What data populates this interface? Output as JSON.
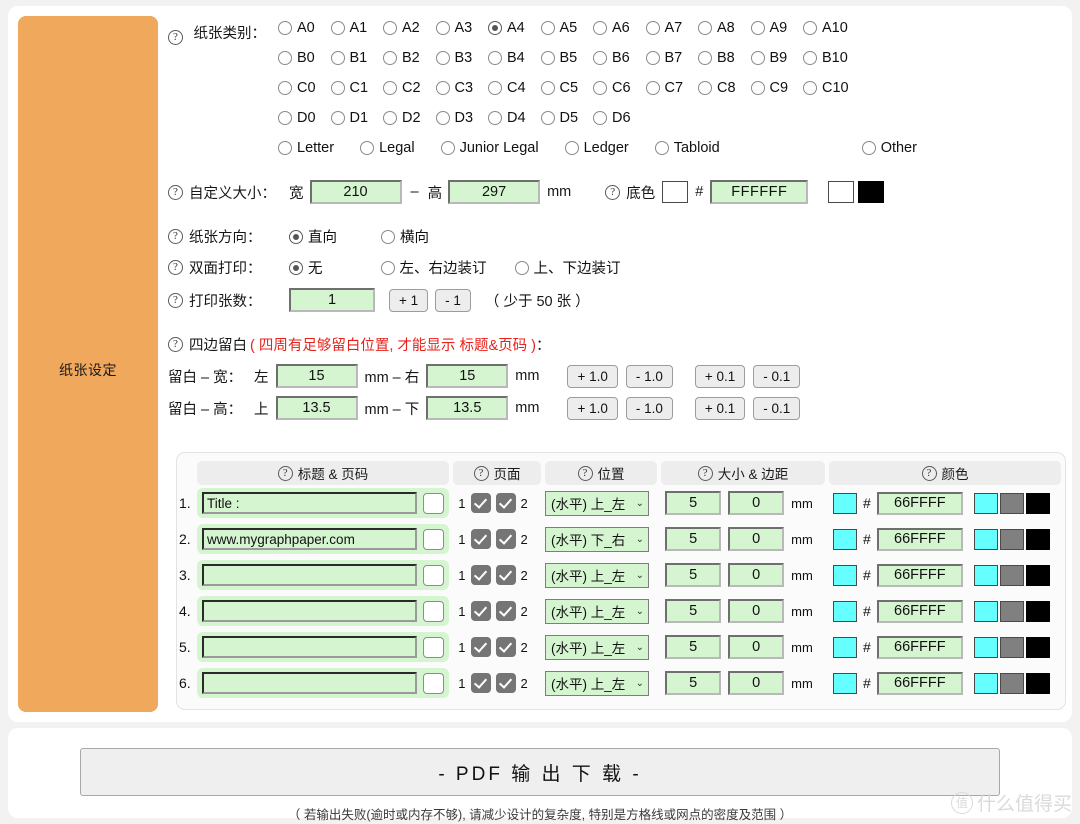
{
  "sidebar": {
    "label": "纸张设定"
  },
  "paper_class": {
    "label": "纸张类别：",
    "rows": [
      [
        "A0",
        "A1",
        "A2",
        "A3",
        "A4",
        "A5",
        "A6",
        "A7",
        "A8",
        "A9",
        "A10"
      ],
      [
        "B0",
        "B1",
        "B2",
        "B3",
        "B4",
        "B5",
        "B6",
        "B7",
        "B8",
        "B9",
        "B10"
      ],
      [
        "C0",
        "C1",
        "C2",
        "C3",
        "C4",
        "C5",
        "C6",
        "C7",
        "C8",
        "C9",
        "C10"
      ],
      [
        "D0",
        "D1",
        "D2",
        "D3",
        "D4",
        "D5",
        "D6"
      ]
    ],
    "named": [
      "Letter",
      "Legal",
      "Junior Legal",
      "Ledger",
      "Tabloid"
    ],
    "other": "Other",
    "selected": "A4"
  },
  "custom_size": {
    "label": "自定义大小：",
    "width_label": "宽",
    "dash": "–",
    "height_label": "高",
    "width_value": "210",
    "height_value": "297",
    "unit": "mm"
  },
  "bg_color": {
    "label": "底色",
    "hash": "#",
    "hex_value": "FFFFFF",
    "swatch": "#FFFFFF",
    "preset_white": "#FFFFFF",
    "preset_black": "#000000"
  },
  "orientation": {
    "label": "纸张方向：",
    "options": [
      "直向",
      "横向"
    ],
    "selected": "直向"
  },
  "duplex": {
    "label": "双面打印：",
    "options": [
      "无",
      "左、右边装订",
      "上、下边装订"
    ],
    "selected": "无"
  },
  "copies": {
    "label": "打印张数：",
    "value": "1",
    "plus": "+ 1",
    "minus": "- 1",
    "note": "（ 少于 50 张 ）"
  },
  "margins": {
    "title": "四边留白",
    "title_note": "( 四周有足够留白位置, 才能显示 标题&页码 )",
    "colon": "：",
    "width_row": {
      "label": "留白 – 宽：",
      "left_label": "左",
      "left_value": "15",
      "unit1": "mm – 右",
      "right_value": "15",
      "unit2": "mm",
      "buttons": [
        "+ 1.0",
        "- 1.0",
        "+ 0.1",
        "- 0.1"
      ]
    },
    "height_row": {
      "label": "留白 – 高：",
      "top_label": "上",
      "top_value": "13.5",
      "unit1": "mm – 下",
      "bottom_value": "13.5",
      "unit2": "mm",
      "buttons": [
        "+ 1.0",
        "- 1.0",
        "+ 0.1",
        "- 0.1"
      ]
    }
  },
  "table": {
    "headers": [
      "标题 & 页码",
      "页面",
      "位置",
      "大小 & 边距",
      "颜色"
    ],
    "page_left_label": "1",
    "page_right_label": "2",
    "unit": "mm",
    "hash": "#",
    "rows": [
      {
        "n": "1.",
        "title": "Title :",
        "placeholder": "",
        "page1": true,
        "page2": true,
        "position": "(水平) 上_左",
        "size": "5",
        "margin": "0",
        "color_hex": "66FFFF",
        "swatch": "#66FFFF",
        "presets": [
          "#66FFFF",
          "#808080",
          "#000000"
        ]
      },
      {
        "n": "2.",
        "title": "www.mygraphpaper.com",
        "placeholder": "",
        "page1": true,
        "page2": true,
        "position": "(水平) 下_右",
        "size": "5",
        "margin": "0",
        "color_hex": "66FFFF",
        "swatch": "#66FFFF",
        "presets": [
          "#66FFFF",
          "#808080",
          "#000000"
        ]
      },
      {
        "n": "3.",
        "title": "",
        "placeholder": "",
        "page1": true,
        "page2": true,
        "position": "(水平) 上_左",
        "size": "5",
        "margin": "0",
        "color_hex": "66FFFF",
        "swatch": "#66FFFF",
        "presets": [
          "#66FFFF",
          "#808080",
          "#000000"
        ]
      },
      {
        "n": "4.",
        "title": "",
        "placeholder": "",
        "page1": true,
        "page2": true,
        "position": "(水平) 上_左",
        "size": "5",
        "margin": "0",
        "color_hex": "66FFFF",
        "swatch": "#66FFFF",
        "presets": [
          "#66FFFF",
          "#808080",
          "#000000"
        ]
      },
      {
        "n": "5.",
        "title": "",
        "placeholder": "",
        "page1": true,
        "page2": true,
        "position": "(水平) 上_左",
        "size": "5",
        "margin": "0",
        "color_hex": "66FFFF",
        "swatch": "#66FFFF",
        "presets": [
          "#66FFFF",
          "#808080",
          "#000000"
        ]
      },
      {
        "n": "6.",
        "title": "",
        "placeholder": "",
        "page1": true,
        "page2": true,
        "position": "(水平) 上_左",
        "size": "5",
        "margin": "0",
        "color_hex": "66FFFF",
        "swatch": "#66FFFF",
        "presets": [
          "#66FFFF",
          "#808080",
          "#000000"
        ]
      }
    ]
  },
  "footer": {
    "pdf_button": "- PDF 输 出 下 载 -",
    "note": "（ 若输出失败(逾时或内存不够), 请减少设计的复杂度, 特别是方格线或网点的密度及范围 ）",
    "watermark": "什么值得买",
    "watermark_badge": "值"
  },
  "icons": {
    "help": "?",
    "chevron_down": "⌄"
  },
  "colors": {
    "sidebar": "#EFA85C",
    "input_green": "#D5F5D0",
    "accent_red": "#E8221B",
    "cyan": "#66FFFF"
  }
}
